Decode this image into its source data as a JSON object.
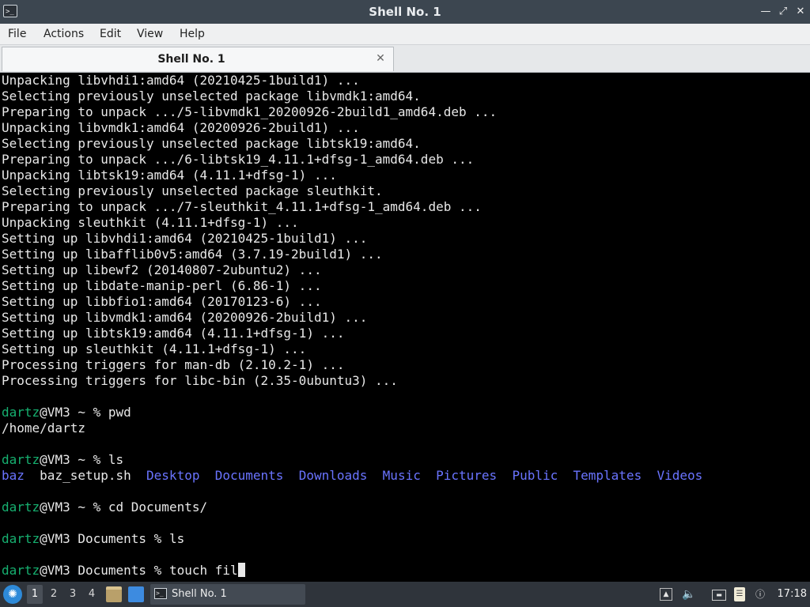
{
  "window": {
    "title": "Shell No. 1",
    "icon": "terminal-icon",
    "controls": [
      "minimize-icon",
      "maximize-icon",
      "close-icon"
    ]
  },
  "menu": {
    "items": [
      "File",
      "Actions",
      "Edit",
      "View",
      "Help"
    ]
  },
  "tabs": [
    {
      "label": "Shell No. 1",
      "close_icon": "close-icon"
    }
  ],
  "terminal": {
    "output_lines": [
      "Unpacking libvhdi1:amd64 (20210425-1build1) ...",
      "Selecting previously unselected package libvmdk1:amd64.",
      "Preparing to unpack .../5-libvmdk1_20200926-2build1_amd64.deb ...",
      "Unpacking libvmdk1:amd64 (20200926-2build1) ...",
      "Selecting previously unselected package libtsk19:amd64.",
      "Preparing to unpack .../6-libtsk19_4.11.1+dfsg-1_amd64.deb ...",
      "Unpacking libtsk19:amd64 (4.11.1+dfsg-1) ...",
      "Selecting previously unselected package sleuthkit.",
      "Preparing to unpack .../7-sleuthkit_4.11.1+dfsg-1_amd64.deb ...",
      "Unpacking sleuthkit (4.11.1+dfsg-1) ...",
      "Setting up libvhdi1:amd64 (20210425-1build1) ...",
      "Setting up libafflib0v5:amd64 (3.7.19-2build1) ...",
      "Setting up libewf2 (20140807-2ubuntu2) ...",
      "Setting up libdate-manip-perl (6.86-1) ...",
      "Setting up libbfio1:amd64 (20170123-6) ...",
      "Setting up libvmdk1:amd64 (20200926-2build1) ...",
      "Setting up libtsk19:amd64 (4.11.1+dfsg-1) ...",
      "Setting up sleuthkit (4.11.1+dfsg-1) ...",
      "Processing triggers for man-db (2.10.2-1) ...",
      "Processing triggers for libc-bin (2.35-0ubuntu3) ..."
    ],
    "prompt_user": "dartz",
    "prompt_host": "@VM3",
    "cmd_pwd": {
      "prompt": " ~ % ",
      "command": "pwd",
      "output": "/home/dartz"
    },
    "cmd_ls_home": {
      "prompt": " ~ % ",
      "command": "ls",
      "entries": [
        {
          "name": "baz",
          "type": "dir"
        },
        {
          "name": "baz_setup.sh",
          "type": "file"
        },
        {
          "name": "Desktop",
          "type": "dir"
        },
        {
          "name": "Documents",
          "type": "dir"
        },
        {
          "name": "Downloads",
          "type": "dir"
        },
        {
          "name": "Music",
          "type": "dir"
        },
        {
          "name": "Pictures",
          "type": "dir"
        },
        {
          "name": "Public",
          "type": "dir"
        },
        {
          "name": "Templates",
          "type": "dir"
        },
        {
          "name": "Videos",
          "type": "dir"
        }
      ]
    },
    "cmd_cd": {
      "prompt": " ~ % ",
      "command": "cd Documents/"
    },
    "cmd_ls_docs": {
      "prompt": " Documents % ",
      "command": "ls"
    },
    "cmd_current": {
      "prompt": " Documents % ",
      "command": "touch fil"
    },
    "colors": {
      "background": "#000000",
      "text": "#e8e8e8",
      "prompt_user": "#16b070",
      "directory": "#6a74ff"
    }
  },
  "taskbar": {
    "start_icon": "app-menu-icon",
    "workspaces": [
      "1",
      "2",
      "3",
      "4"
    ],
    "active_workspace": "1",
    "launchers": [
      "file-manager-icon",
      "show-desktop-icon"
    ],
    "task_label": "Shell No. 1",
    "tray_icons": [
      "volume-icon",
      "speaker-icon",
      "network-icon",
      "clipboard-icon",
      "update-notifier-icon"
    ],
    "clock": "17:18"
  }
}
